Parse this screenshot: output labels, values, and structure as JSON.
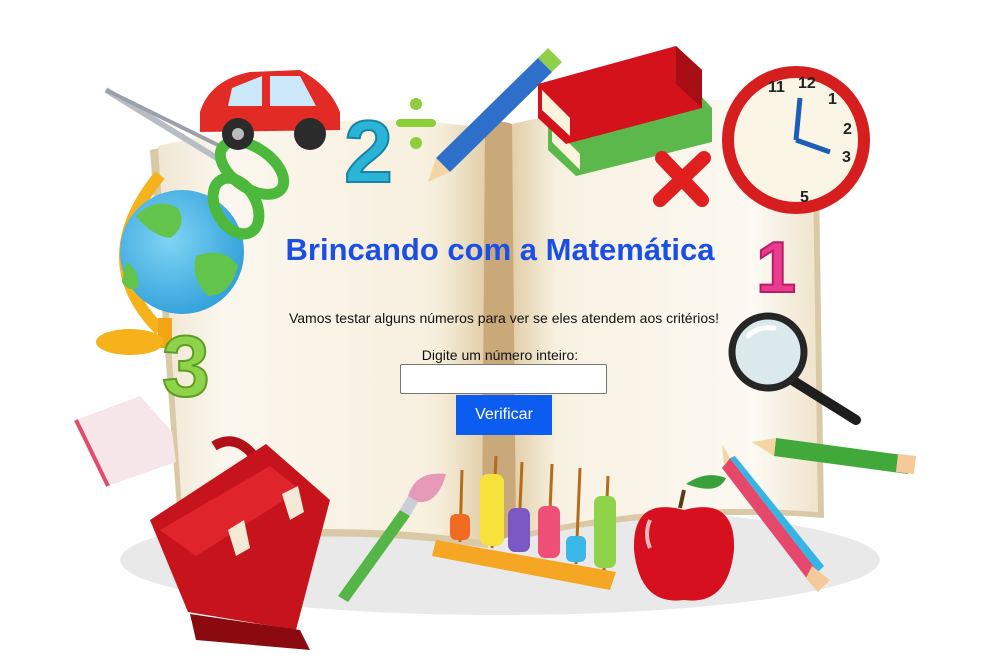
{
  "page": {
    "title": "Brincando com a Matemática",
    "subtitle": "Vamos testar alguns números para ver se eles atendem aos critérios!",
    "input_label": "Digite um número inteiro:",
    "input_value": "",
    "button_label": "Verificar"
  },
  "background": {
    "clock_numbers": [
      "12",
      "11",
      "1",
      "2",
      "3",
      "5"
    ],
    "decor_digits": [
      "2",
      "3",
      "1"
    ],
    "colors": {
      "title": "#1a4fe6",
      "button": "#0d5cf0",
      "page_paper": "#f7f1e4",
      "red": "#d4121c",
      "green": "#5cc63a"
    }
  }
}
